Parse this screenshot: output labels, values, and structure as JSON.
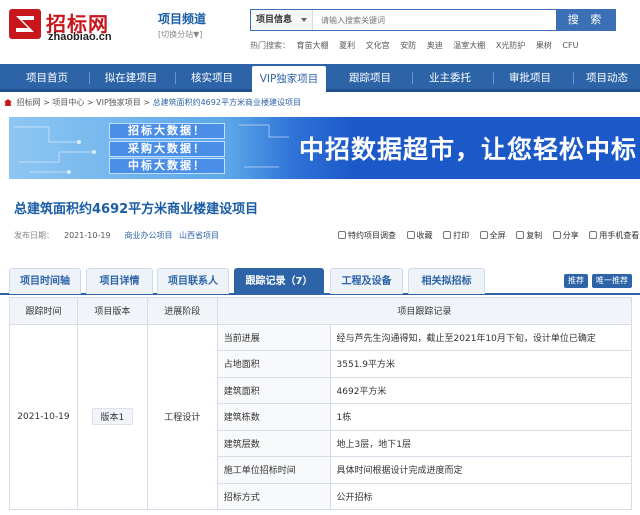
{
  "header": {
    "logo_cn": "招标网",
    "logo_en": "zhaobiao.cn",
    "channel_title": "项目频道",
    "channel_switch": "[切换分站▼]",
    "search_type": "项目信息",
    "search_placeholder": "请输入搜索关键词",
    "search_button": "搜 索",
    "hot_label": "热门搜索：",
    "hot_terms": [
      "育苗大棚",
      "夏利",
      "文化宫",
      "安防",
      "奥迪",
      "温室大棚",
      "X光防护",
      "果树",
      "CFU"
    ]
  },
  "nav": {
    "items": [
      "项目首页",
      "拟在建项目",
      "核实项目",
      "VIP独家项目",
      "跟踪项目",
      "业主委托",
      "审批项目",
      "项目动态"
    ],
    "active_index": 3
  },
  "breadcrumb": {
    "items": [
      "招标网",
      "项目中心",
      "VIP独家项目"
    ],
    "current": "总建筑面积约4692平方米商业楼建设项目"
  },
  "banner": {
    "buttons": [
      "招标大数据！",
      "采购大数据！",
      "中标大数据！"
    ],
    "slogan": "中招数据超市，让您轻松中标"
  },
  "project": {
    "title": "总建筑面积约4692平方米商业楼建设项目",
    "date_label": "发布日期：",
    "date": "2021-10-19",
    "tag_1": "商业办公项目",
    "tag_2": "山西省项目"
  },
  "tools": [
    "特约项目调查",
    "收藏",
    "打印",
    "全屏",
    "复制",
    "分享",
    "用手机查看"
  ],
  "tabs": {
    "items": [
      "项目时间轴",
      "项目详情",
      "项目联系人",
      "跟踪记录（7）",
      "工程及设备",
      "相关拟招标"
    ],
    "active_index": 3,
    "btn_recommend": "推荐",
    "btn_unique": "唯一推荐"
  },
  "table": {
    "headers": [
      "跟踪时间",
      "项目版本",
      "进展阶段",
      "项目跟踪记录"
    ],
    "date": "2021-10-19",
    "version": "版本1",
    "stage": "工程设计",
    "rows": [
      {
        "label": "当前进展",
        "value": "经与芦先生沟通得知，截止至2021年10月下旬，设计单位已确定"
      },
      {
        "label": "占地面积",
        "value": "3551.9平方米"
      },
      {
        "label": "建筑面积",
        "value": "4692平方米"
      },
      {
        "label": "建筑栋数",
        "value": "1栋"
      },
      {
        "label": "建筑层数",
        "value": "地上3层，地下1层"
      },
      {
        "label": "施工单位招标时间",
        "value": "具体时间根据设计完成进度而定"
      },
      {
        "label": "招标方式",
        "value": "公开招标"
      }
    ]
  },
  "colors": {
    "brand_red": "#c8161d",
    "primary_blue": "#2d64a8",
    "banner_blue": "#1b58c8"
  }
}
